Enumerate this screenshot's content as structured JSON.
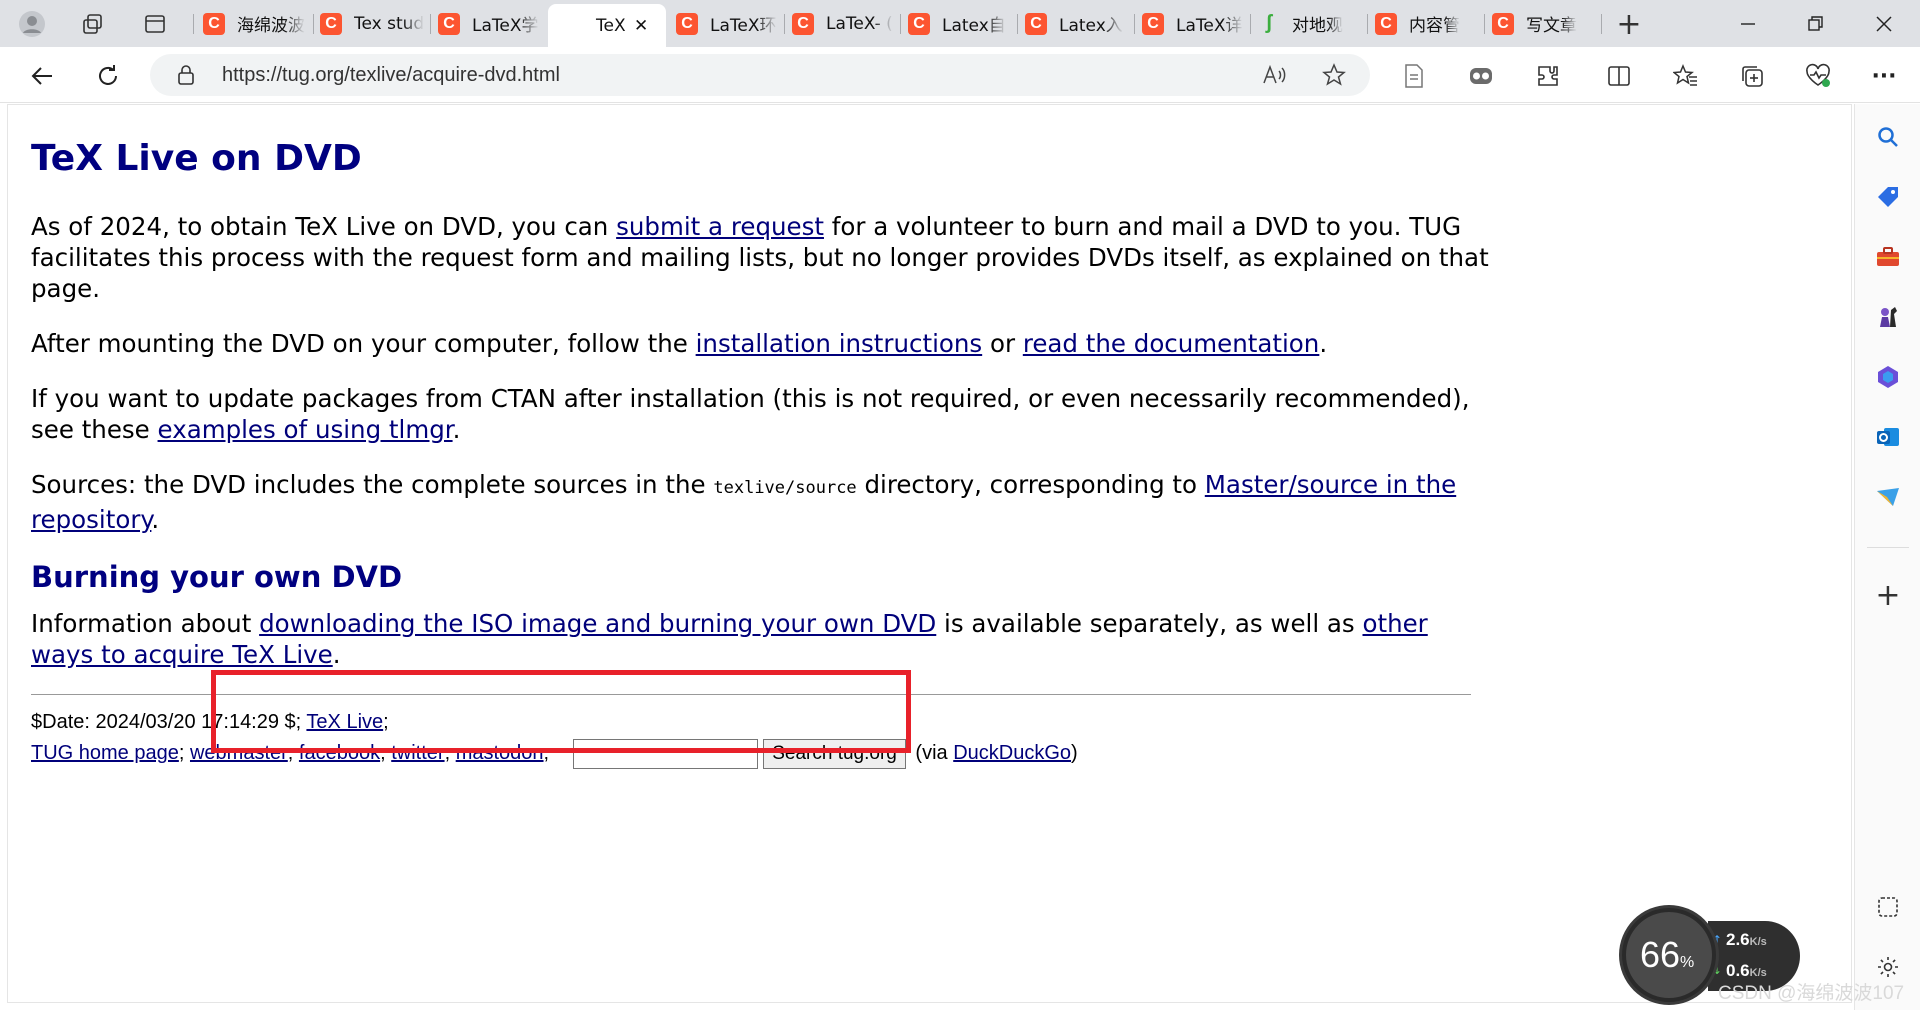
{
  "tabs": [
    {
      "title": "海绵波波",
      "icon": "csdn-icon"
    },
    {
      "title": "Tex stud",
      "icon": "csdn-icon"
    },
    {
      "title": "LaTeX学",
      "icon": "csdn-icon"
    },
    {
      "title": "TeX",
      "icon": "",
      "active": true
    },
    {
      "title": "LaTeX环",
      "icon": "csdn-icon"
    },
    {
      "title": "LaTeX- (",
      "icon": "csdn-icon"
    },
    {
      "title": "Latex自",
      "icon": "csdn-icon"
    },
    {
      "title": "Latex入",
      "icon": "csdn-icon"
    },
    {
      "title": "LaTeX详",
      "icon": "csdn-icon"
    },
    {
      "title": "对地观",
      "icon": "leaf-icon"
    },
    {
      "title": "内容管",
      "icon": "csdn-icon"
    },
    {
      "title": "写文章",
      "icon": "csdn-icon"
    }
  ],
  "tab_fav_letter": "C",
  "tab_fav_leaf": "ʃ",
  "close_glyph": "✕",
  "new_tab_glyph": "+",
  "address": {
    "url": "https://tug.org/texlive/acquire-dvd.html"
  },
  "page": {
    "title": "TeX Live on DVD",
    "p1_a": "As of 2024, to obtain TeX Live on DVD, you can ",
    "p1_link": "submit a request",
    "p1_b": " for a volunteer to burn and mail a DVD to you. TUG facilitates this process with the request form and mailing lists, but no longer provides DVDs itself, as explained on that page.",
    "p2_a": "After mounting the DVD on your computer, follow the ",
    "p2_link1": "installation instructions",
    "p2_b": " or ",
    "p2_link2": "read the documentation",
    "p2_c": ".",
    "p3_a": "If you want to update packages from CTAN after installation (this is not required, or even necessarily recommended), see these ",
    "p3_link": "examples of using tlmgr",
    "p3_b": ".",
    "p4_a": "Sources: the DVD includes the complete sources in the ",
    "p4_code": "texlive/source",
    "p4_b": " directory, corresponding to ",
    "p4_link": "Master/source in the repository",
    "p4_c": ".",
    "h2": "Burning your own DVD",
    "p5_a": "Information about ",
    "p5_link1": "downloading the ISO image and burning your own DVD",
    "p5_b": " is available separately, as well as ",
    "p5_link2": "other ways to acquire TeX Live",
    "p5_c": "."
  },
  "footer": {
    "date": "$Date: 2024/03/20 17:14:29 $; ",
    "texlive_link": "TeX Live",
    "semi": ";",
    "links": [
      "TUG home page",
      "webmaster",
      "facebook",
      "twitter",
      "mastodon"
    ],
    "search_button": "Search tug.org",
    "via_a": "(via ",
    "via_link": "DuckDuckGo",
    "via_b": ")"
  },
  "widget": {
    "percent": "66",
    "percent_unit": "%",
    "up": "2.6",
    "down": "0.6",
    "speed_unit": "K/s"
  },
  "watermark": "CSDN @海绵波波107",
  "colors": {
    "link": "#00007a",
    "heading": "#000080",
    "highlight": "#e8212a",
    "csdn": "#fc5531"
  }
}
